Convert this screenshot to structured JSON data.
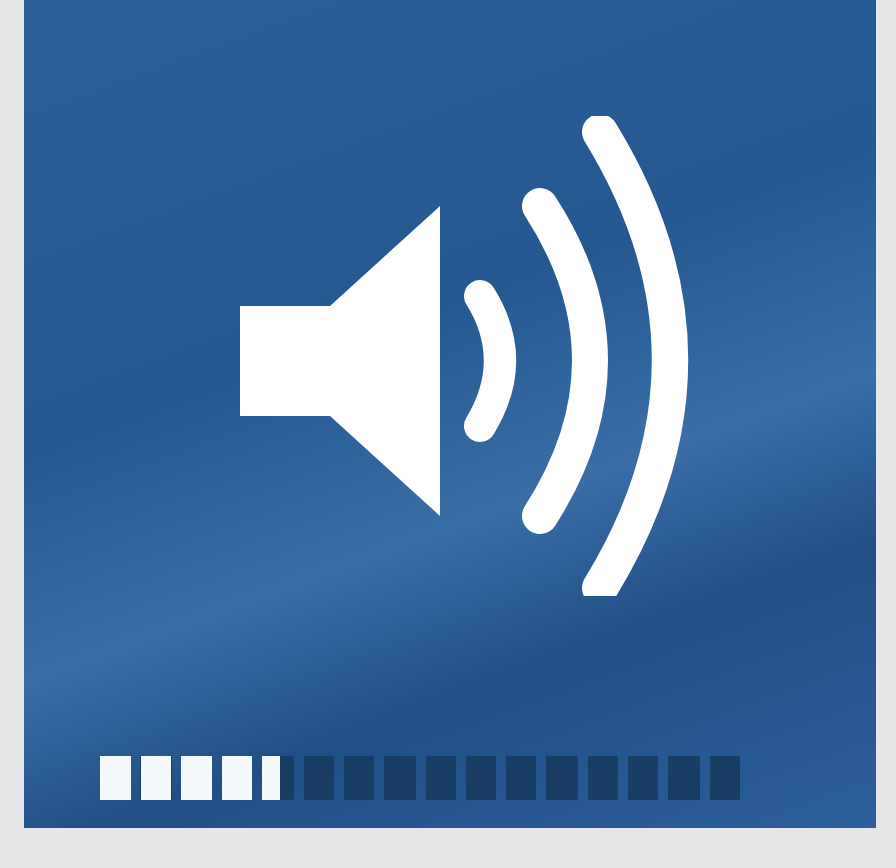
{
  "volume": {
    "level": 0.28
  }
}
